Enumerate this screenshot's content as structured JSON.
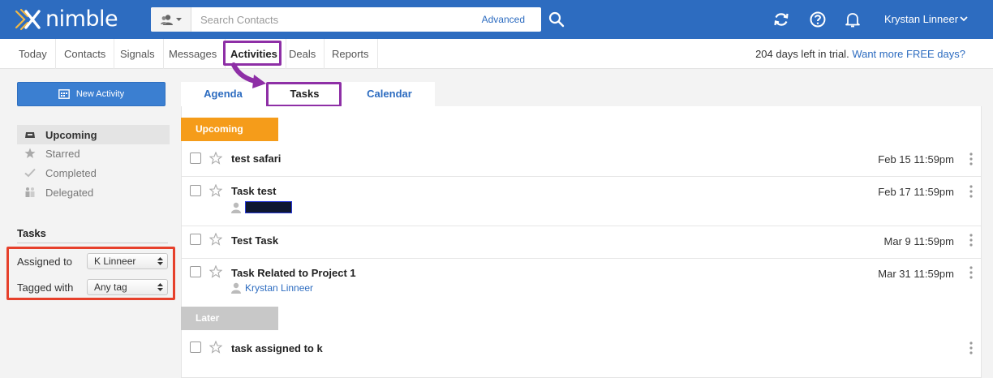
{
  "header": {
    "logo_text": "nimble",
    "search": {
      "placeholder": "Search Contacts",
      "advanced_label": "Advanced"
    },
    "user_name": "Krystan Linneer",
    "icons": [
      "refresh-icon",
      "help-icon",
      "bell-icon",
      "chevron-down-icon"
    ]
  },
  "nav": {
    "items": [
      "Today",
      "Contacts",
      "Signals",
      "Messages",
      "Activities",
      "Deals",
      "Reports"
    ],
    "active": "Activities",
    "trial_text": "204 days left in trial.",
    "trial_link": "Want more FREE days?"
  },
  "sidebar": {
    "new_activity_label": "New Activity",
    "filters": [
      {
        "label": "Upcoming",
        "icon": "inbox-icon",
        "active": true
      },
      {
        "label": "Starred",
        "icon": "star-icon",
        "active": false
      },
      {
        "label": "Completed",
        "icon": "check-icon",
        "active": false
      },
      {
        "label": "Delegated",
        "icon": "delegated-icon",
        "active": false
      }
    ],
    "tasks_heading": "Tasks",
    "assigned_to": {
      "label": "Assigned to",
      "value": "K Linneer"
    },
    "tagged_with": {
      "label": "Tagged with",
      "value": "Any tag"
    }
  },
  "tabs": [
    "Agenda",
    "Tasks",
    "Calendar"
  ],
  "active_tab": "Tasks",
  "groups": {
    "upcoming": {
      "label": "Upcoming",
      "tasks": [
        {
          "title": "test safari",
          "date": "Feb 15 11:59pm"
        },
        {
          "title": "Task test",
          "date": "Feb 17 11:59pm"
        },
        {
          "title": "Test Task",
          "date": "Mar 9 11:59pm"
        },
        {
          "title": "Task Related to Project 1",
          "date": "Mar 31 11:59pm",
          "assignee": "Krystan Linneer"
        }
      ]
    },
    "later": {
      "label": "Later",
      "tasks": [
        {
          "title": "task assigned to k",
          "date": ""
        }
      ]
    }
  },
  "colors": {
    "header_blue": "#2d6cc0",
    "upcoming_orange": "#f59c1a",
    "later_gray": "#c8c8c8",
    "highlight_purple": "#8e2fa6",
    "highlight_red": "#e6402b"
  }
}
